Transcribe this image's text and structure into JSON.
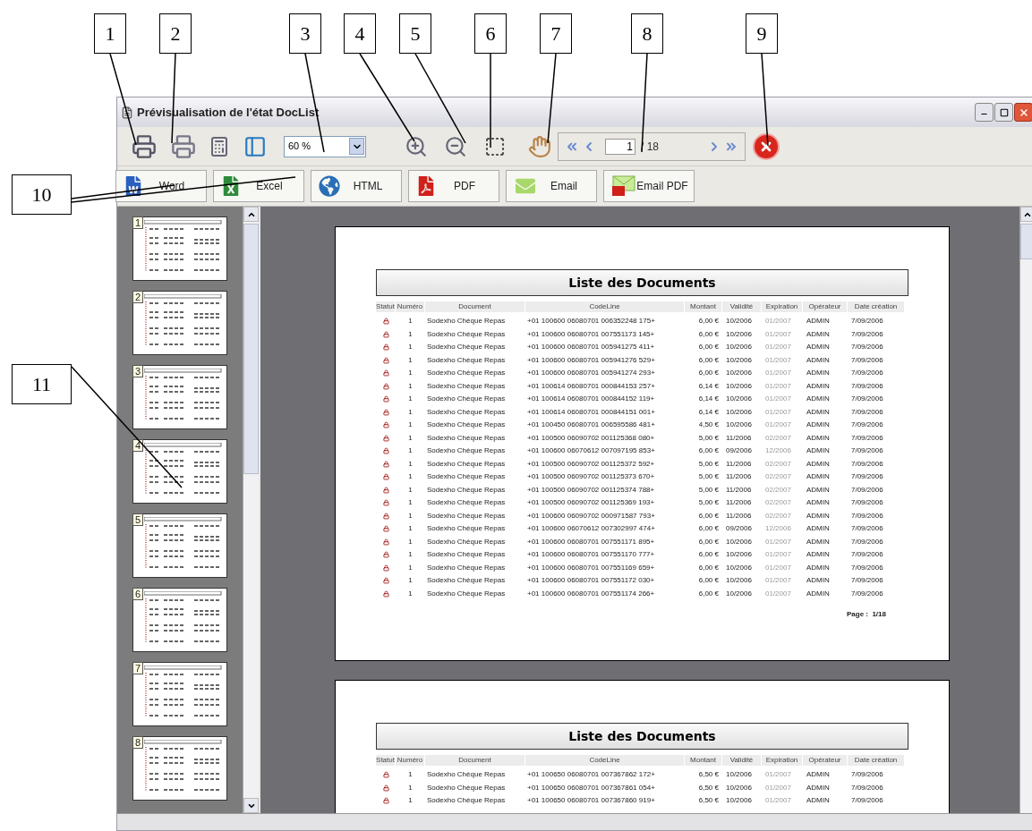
{
  "callouts": [
    {
      "label": "1"
    },
    {
      "label": "2"
    },
    {
      "label": "3"
    },
    {
      "label": "4"
    },
    {
      "label": "5"
    },
    {
      "label": "6"
    },
    {
      "label": "7"
    },
    {
      "label": "8"
    },
    {
      "label": "9"
    },
    {
      "label": "10"
    },
    {
      "label": "11"
    }
  ],
  "window": {
    "title": "Prévisualisation de l'état DocList"
  },
  "toolbar": {
    "zoom": "60 %",
    "page_input": "1",
    "page_total": "/ 18"
  },
  "export_buttons": [
    {
      "kind": "word",
      "label": "Word"
    },
    {
      "kind": "excel",
      "label": "Excel"
    },
    {
      "kind": "html",
      "label": "HTML"
    },
    {
      "kind": "pdf",
      "label": "PDF"
    },
    {
      "kind": "email",
      "label": "Email"
    },
    {
      "kind": "emailpdf",
      "label": "Email PDF"
    }
  ],
  "thumbnails": [
    "1",
    "2",
    "3",
    "4",
    "5",
    "6",
    "7",
    "8"
  ],
  "pages": [
    {
      "title": "Liste des Documents",
      "footer": "Page :  1/18",
      "columns": [
        "Statut",
        "Numéro",
        "Document",
        "CodeLine",
        "Montant",
        "Validité",
        "Expiration",
        "Opérateur",
        "Date création"
      ],
      "rows": [
        [
          "",
          "1",
          "Sodexho Chèque Repas",
          "+01 100600 06080701 006352248 175+",
          "6,00 €",
          "10/2006",
          "01/2007",
          "ADMIN",
          "7/09/2006"
        ],
        [
          "",
          "1",
          "Sodexho Chèque Repas",
          "+01 100600 06080701 007551173 145+",
          "6,00 €",
          "10/2006",
          "01/2007",
          "ADMIN",
          "7/09/2006"
        ],
        [
          "",
          "1",
          "Sodexho Chèque Repas",
          "+01 100600 06080701 005941275 411+",
          "6,00 €",
          "10/2006",
          "01/2007",
          "ADMIN",
          "7/09/2006"
        ],
        [
          "",
          "1",
          "Sodexho Chèque Repas",
          "+01 100600 06080701 005941276 529+",
          "6,00 €",
          "10/2006",
          "01/2007",
          "ADMIN",
          "7/09/2006"
        ],
        [
          "",
          "1",
          "Sodexho Chèque Repas",
          "+01 100600 06080701 005941274 293+",
          "6,00 €",
          "10/2006",
          "01/2007",
          "ADMIN",
          "7/09/2006"
        ],
        [
          "",
          "1",
          "Sodexho Chèque Repas",
          "+01 100614 06080701 000844153 257+",
          "6,14 €",
          "10/2006",
          "01/2007",
          "ADMIN",
          "7/09/2006"
        ],
        [
          "",
          "1",
          "Sodexho Chèque Repas",
          "+01 100614 06080701 000844152 119+",
          "6,14 €",
          "10/2006",
          "01/2007",
          "ADMIN",
          "7/09/2006"
        ],
        [
          "",
          "1",
          "Sodexho Chèque Repas",
          "+01 100614 06080701 000844151 001+",
          "6,14 €",
          "10/2006",
          "01/2007",
          "ADMIN",
          "7/09/2006"
        ],
        [
          "",
          "1",
          "Sodexho Chèque Repas",
          "+01 100450 06080701 006595586 481+",
          "4,50 €",
          "10/2006",
          "01/2007",
          "ADMIN",
          "7/09/2006"
        ],
        [
          "",
          "1",
          "Sodexho Chèque Repas",
          "+01 100500 06090702 001125368 080+",
          "5,00 €",
          "11/2006",
          "02/2007",
          "ADMIN",
          "7/09/2006"
        ],
        [
          "",
          "1",
          "Sodexho Chèque Repas",
          "+01 100600 06070612 007097195 853+",
          "6,00 €",
          "09/2006",
          "12/2006",
          "ADMIN",
          "7/09/2006"
        ],
        [
          "",
          "1",
          "Sodexho Chèque Repas",
          "+01 100500 06090702 001125372 592+",
          "5,00 €",
          "11/2006",
          "02/2007",
          "ADMIN",
          "7/09/2006"
        ],
        [
          "",
          "1",
          "Sodexho Chèque Repas",
          "+01 100500 06090702 001125373 670+",
          "5,00 €",
          "11/2006",
          "02/2007",
          "ADMIN",
          "7/09/2006"
        ],
        [
          "",
          "1",
          "Sodexho Chèque Repas",
          "+01 100500 06090702 001125374 788+",
          "5,00 €",
          "11/2006",
          "02/2007",
          "ADMIN",
          "7/09/2006"
        ],
        [
          "",
          "1",
          "Sodexho Chèque Repas",
          "+01 100500 06090702 001125369 193+",
          "5,00 €",
          "11/2006",
          "02/2007",
          "ADMIN",
          "7/09/2006"
        ],
        [
          "",
          "1",
          "Sodexho Chèque Repas",
          "+01 100600 06090702 000971587 793+",
          "6,00 €",
          "11/2006",
          "02/2007",
          "ADMIN",
          "7/09/2006"
        ],
        [
          "",
          "1",
          "Sodexho Chèque Repas",
          "+01 100600 06070612 007302997 474+",
          "6,00 €",
          "09/2006",
          "12/2006",
          "ADMIN",
          "7/09/2006"
        ],
        [
          "",
          "1",
          "Sodexho Chèque Repas",
          "+01 100600 06080701 007551171 895+",
          "6,00 €",
          "10/2006",
          "01/2007",
          "ADMIN",
          "7/09/2006"
        ],
        [
          "",
          "1",
          "Sodexho Chèque Repas",
          "+01 100600 06080701 007551170 777+",
          "6,00 €",
          "10/2006",
          "01/2007",
          "ADMIN",
          "7/09/2006"
        ],
        [
          "",
          "1",
          "Sodexho Chèque Repas",
          "+01 100600 06080701 007551169 659+",
          "6,00 €",
          "10/2006",
          "01/2007",
          "ADMIN",
          "7/09/2006"
        ],
        [
          "",
          "1",
          "Sodexho Chèque Repas",
          "+01 100600 06080701 007551172 030+",
          "6,00 €",
          "10/2006",
          "01/2007",
          "ADMIN",
          "7/09/2006"
        ],
        [
          "",
          "1",
          "Sodexho Chèque Repas",
          "+01 100600 06080701 007551174 266+",
          "6,00 €",
          "10/2006",
          "01/2007",
          "ADMIN",
          "7/09/2006"
        ]
      ]
    },
    {
      "title": "Liste des Documents",
      "columns": [
        "Statut",
        "Numéro",
        "Document",
        "CodeLine",
        "Montant",
        "Validité",
        "Expiration",
        "Opérateur",
        "Date création"
      ],
      "rows": [
        [
          "",
          "1",
          "Sodexho Chèque Repas",
          "+01 100650 06080701 007367862 172+",
          "6,50 €",
          "10/2006",
          "01/2007",
          "ADMIN",
          "7/09/2006"
        ],
        [
          "",
          "1",
          "Sodexho Chèque Repas",
          "+01 100650 06080701 007367861 054+",
          "6,50 €",
          "10/2006",
          "01/2007",
          "ADMIN",
          "7/09/2006"
        ],
        [
          "",
          "1",
          "Sodexho Chèque Repas",
          "+01 100650 06080701 007367860 919+",
          "6,50 €",
          "10/2006",
          "01/2007",
          "ADMIN",
          "7/09/2006"
        ]
      ]
    }
  ]
}
